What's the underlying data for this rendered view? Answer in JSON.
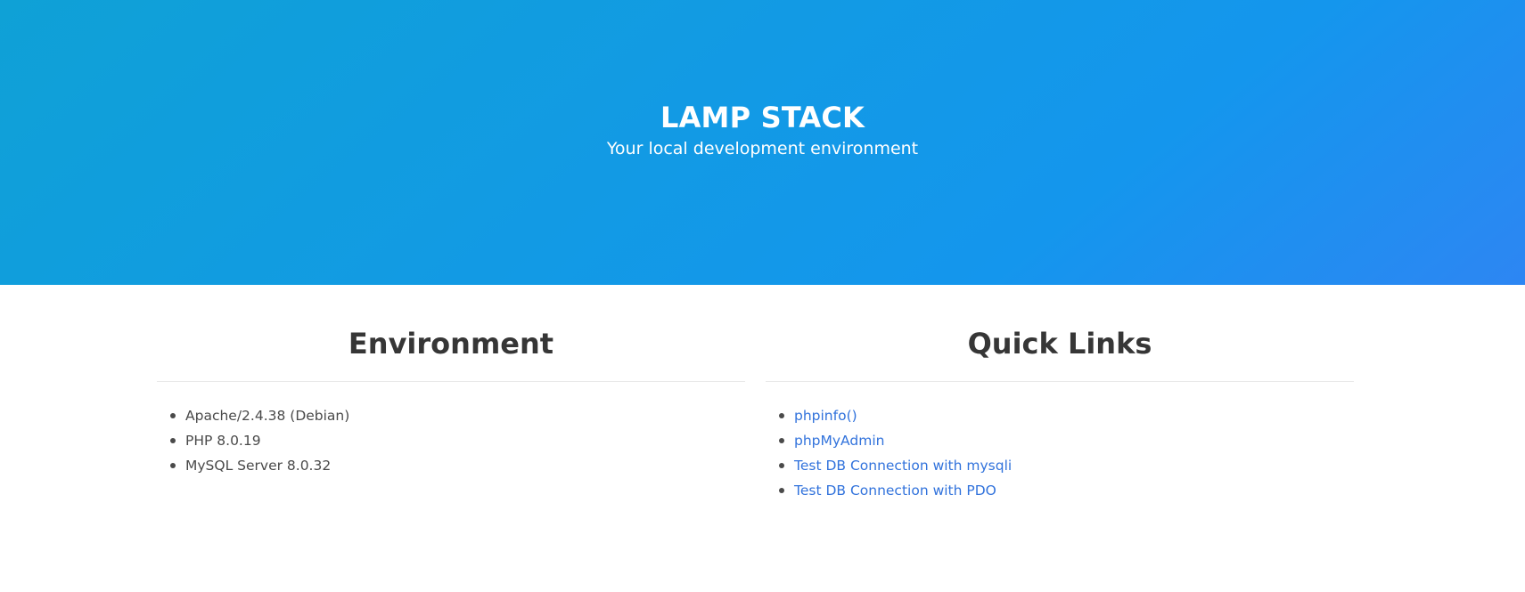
{
  "hero": {
    "title": "LAMP STACK",
    "subtitle": "Your local development environment"
  },
  "environment": {
    "title": "Environment",
    "items": [
      "Apache/2.4.38 (Debian)",
      "PHP 8.0.19",
      "MySQL Server 8.0.32"
    ]
  },
  "quick_links": {
    "title": "Quick Links",
    "items": [
      "phpinfo()",
      "phpMyAdmin",
      "Test DB Connection with mysqli",
      "Test DB Connection with PDO"
    ]
  },
  "colors": {
    "hero_gradient_start": "#0fa1d6",
    "hero_gradient_end": "#2d86f3",
    "link": "#3273dc",
    "heading": "#363636",
    "text": "#4a4a4a"
  }
}
